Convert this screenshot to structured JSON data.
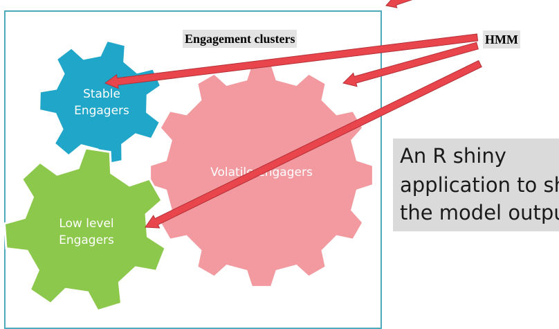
{
  "diagram": {
    "title": "Engagement clusters",
    "model_label": "HMM",
    "clusters": [
      {
        "label_line1": "Stable",
        "label_line2": "Engagers",
        "color": "#1fa6c9"
      },
      {
        "label_line1": "Volatile Engagers",
        "label_line2": "",
        "color": "#f29aa0"
      },
      {
        "label_line1": "Low level",
        "label_line2": "Engagers",
        "color": "#8cc84b"
      }
    ],
    "note": {
      "line1": "An R shiny",
      "line2": "application to sh",
      "line3": "the model outpu"
    },
    "colors": {
      "frame": "#4fa9bd",
      "arrow": "#e8454d",
      "label_background": "#e3e3e3",
      "note_background": "#dadada"
    }
  }
}
